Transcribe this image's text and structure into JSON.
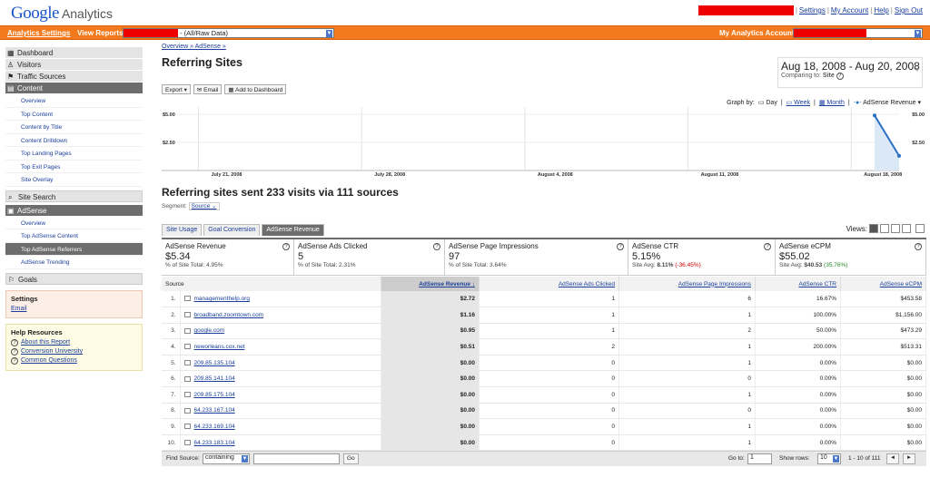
{
  "header": {
    "logo_google": "Google",
    "logo_analytics": "Analytics",
    "links": [
      "Settings",
      "My Account",
      "Help",
      "Sign Out"
    ]
  },
  "orangebar": {
    "settings_link": "Analytics Settings",
    "view_reports_label": "View Reports:",
    "profile_value": "- (All/Raw Data)",
    "accounts_label": "My Analytics Accounts:"
  },
  "sidebar": {
    "top": [
      {
        "label": "Dashboard",
        "icon": "dashboard-icon"
      },
      {
        "label": "Visitors",
        "icon": "person-icon"
      },
      {
        "label": "Traffic Sources",
        "icon": "traffic-icon"
      }
    ],
    "content_label": "Content",
    "content_items": [
      "Overview",
      "Top Content",
      "Content by Title",
      "Content Drilldown",
      "Top Landing Pages",
      "Top Exit Pages",
      "Site Overlay"
    ],
    "site_search": "Site Search",
    "adsense_label": "AdSense",
    "adsense_items": [
      "Overview",
      "Top AdSense Content",
      "Top AdSense Referrers",
      "AdSense Trending"
    ],
    "goals": "Goals",
    "settings": {
      "title": "Settings",
      "email": "Email"
    },
    "help": {
      "title": "Help Resources",
      "items": [
        "About this Report",
        "Conversion University",
        "Common Questions"
      ]
    }
  },
  "main": {
    "breadcrumb": "Overview » AdSense »",
    "title": "Referring Sites",
    "date_range": "Aug 18, 2008 - Aug 20, 2008",
    "comparing_label": "Comparing to:",
    "comparing_value": "Site",
    "toolbar": {
      "export": "Export",
      "email": "Email",
      "add_dashboard": "Add to Dashboard"
    },
    "graph_by": {
      "label": "Graph by:",
      "day": "Day",
      "week": "Week",
      "month": "Month",
      "metric": "AdSense Revenue"
    },
    "headline": "Referring sites sent 233 visits via 111 sources",
    "segment_label": "Segment:",
    "segment_value": "Source",
    "tabs": [
      "Site Usage",
      "Goal Conversion",
      "AdSense Revenue"
    ],
    "views_label": "Views:"
  },
  "chart_data": {
    "type": "line",
    "x": [
      "2008-07-21",
      "2008-07-28",
      "2008-08-04",
      "2008-08-11",
      "2008-08-18"
    ],
    "x_tick_labels": [
      "July 21, 2008",
      "July 28, 2008",
      "August 4, 2008",
      "August 11, 2008",
      "August 18, 2008"
    ],
    "y_tick_labels": [
      "$5.00",
      "$2.50"
    ],
    "ylim": [
      0,
      5
    ],
    "series": [
      {
        "name": "AdSense Revenue",
        "values": [
          0,
          0,
          0,
          0,
          0,
          0,
          0,
          0,
          0,
          0,
          0,
          0,
          0,
          0,
          0,
          0,
          0,
          0,
          0,
          0,
          0,
          0,
          0,
          0,
          0,
          0,
          0,
          0,
          0,
          0,
          4.9,
          1.3
        ]
      }
    ],
    "accent": "#2a6fc4"
  },
  "metrics": [
    {
      "title": "AdSense Revenue",
      "value": "$5.34",
      "sub": "% of Site Total: 4.95%"
    },
    {
      "title": "AdSense Ads Clicked",
      "value": "5",
      "sub": "% of Site Total: 2.31%"
    },
    {
      "title": "AdSense Page Impressions",
      "value": "97",
      "sub": "% of Site Total: 3.64%"
    },
    {
      "title": "AdSense CTR",
      "value": "5.15%",
      "sub": "Site Avg: ",
      "sub_val": "8.11%",
      "sub_delta": "(-36.45%)",
      "delta_color": "neg"
    },
    {
      "title": "AdSense eCPM",
      "value": "$55.02",
      "sub": "Site Avg: ",
      "sub_val": "$40.53",
      "sub_delta": "(35.76%)",
      "delta_color": "pos"
    }
  ],
  "table": {
    "columns": [
      "Source",
      "AdSense Revenue",
      "AdSense Ads Clicked",
      "AdSense Page Impressions",
      "AdSense CTR",
      "AdSense eCPM"
    ],
    "rows": [
      [
        "1.",
        "managementhelp.org",
        "$2.72",
        "1",
        "6",
        "16.67%",
        "$453.58"
      ],
      [
        "2.",
        "broadband.zoomtown.com",
        "$1.16",
        "1",
        "1",
        "100.00%",
        "$1,156.00"
      ],
      [
        "3.",
        "google.com",
        "$0.95",
        "1",
        "2",
        "50.00%",
        "$473.29"
      ],
      [
        "4.",
        "neworleans.cox.net",
        "$0.51",
        "2",
        "1",
        "200.00%",
        "$513.31"
      ],
      [
        "5.",
        "209.85.135.104",
        "$0.00",
        "0",
        "1",
        "0.00%",
        "$0.00"
      ],
      [
        "6.",
        "209.85.141.104",
        "$0.00",
        "0",
        "0",
        "0.00%",
        "$0.00"
      ],
      [
        "7.",
        "209.85.175.104",
        "$0.00",
        "0",
        "1",
        "0.00%",
        "$0.00"
      ],
      [
        "8.",
        "64.233.167.104",
        "$0.00",
        "0",
        "0",
        "0.00%",
        "$0.00"
      ],
      [
        "9.",
        "64.233.169.104",
        "$0.00",
        "0",
        "1",
        "0.00%",
        "$0.00"
      ],
      [
        "10.",
        "64.233.183.104",
        "$0.00",
        "0",
        "1",
        "0.00%",
        "$0.00"
      ]
    ]
  },
  "footer": {
    "find_source": "Find Source:",
    "containing": "containing",
    "go": "Go",
    "go_to": "Go to:",
    "go_to_value": "1",
    "show_rows": "Show rows:",
    "show_rows_value": "10",
    "range": "1 - 10 of 111"
  }
}
